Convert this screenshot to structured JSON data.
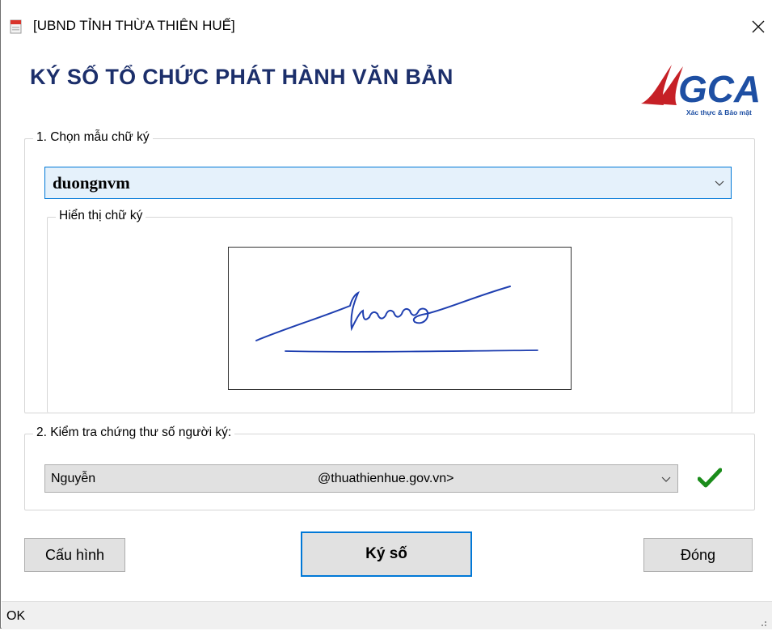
{
  "window": {
    "title": "[UBND TỈNH THỪA THIÊN HUẾ]",
    "close_icon": "close-icon",
    "app_icon": "pdf-document-icon"
  },
  "header": {
    "heading": "KÝ SỐ TỔ CHỨC PHÁT HÀNH VĂN BẢN",
    "logo_text": "VGCA",
    "logo_tagline": "Xác thực & Bảo mật"
  },
  "section1": {
    "label": "1. Chọn mẫu chữ ký",
    "selected_template": "duongnvm",
    "preview_label": "Hiển thị chữ ký"
  },
  "section2": {
    "label": "2. Kiểm tra chứng thư số người ký:",
    "certificate_name": "Nguyễn",
    "certificate_email": "@thuathienhue.gov.vn>",
    "valid_icon": "check-icon",
    "valid_color": "#1a8c1a"
  },
  "buttons": {
    "config": "Cấu hình",
    "sign": "Ký số",
    "close": "Đóng"
  },
  "status": {
    "text": "OK"
  },
  "colors": {
    "heading": "#1c2f6b",
    "selection": "#e5f1fb",
    "selection_border": "#0078d7",
    "logo_red": "#c62026",
    "logo_blue": "#1e4fa3"
  }
}
